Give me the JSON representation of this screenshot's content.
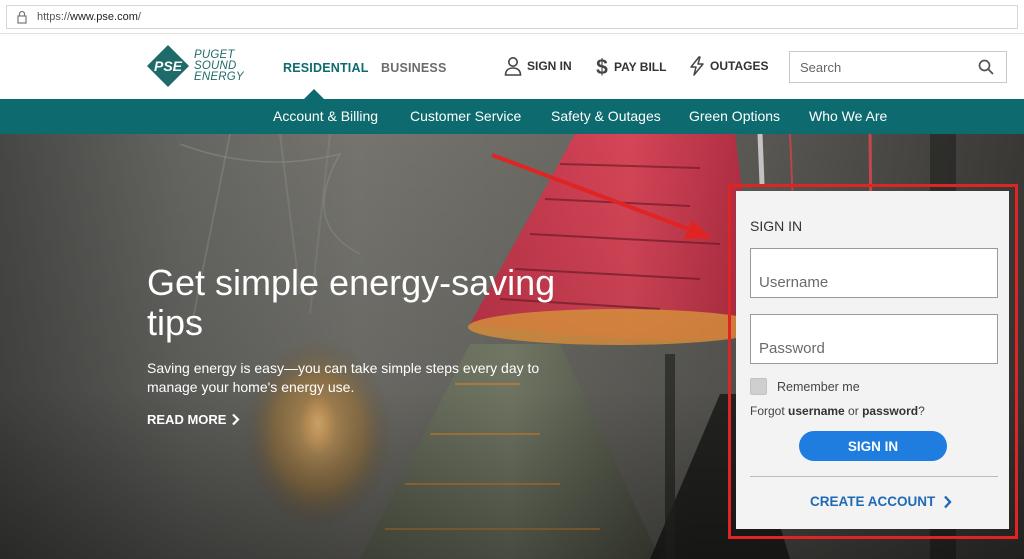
{
  "browser": {
    "url_scheme": "https://",
    "url_host": "www.pse.com",
    "url_path": "/"
  },
  "header": {
    "logo": {
      "mark": "PSE",
      "line1": "PUGET",
      "line2": "SOUND",
      "line3": "ENERGY"
    },
    "tabs": [
      {
        "label": "RESIDENTIAL",
        "active": true
      },
      {
        "label": "BUSINESS",
        "active": false
      }
    ],
    "utilities": [
      {
        "label": "SIGN IN",
        "icon": "user-icon"
      },
      {
        "label": "PAY BILL",
        "icon": "dollar-icon"
      },
      {
        "label": "OUTAGES",
        "icon": "lightning-icon"
      }
    ],
    "search": {
      "placeholder": "Search",
      "value": ""
    }
  },
  "mainnav": {
    "items": [
      "Account & Billing",
      "Customer Service",
      "Safety & Outages",
      "Green Options",
      "Who We Are"
    ]
  },
  "hero": {
    "title": "Get simple energy-saving tips",
    "description": "Saving energy is easy—you can take simple steps every day to manage your home's energy use.",
    "cta": "READ MORE"
  },
  "signin": {
    "title": "SIGN IN",
    "username_placeholder": "Username",
    "password_placeholder": "Password",
    "remember_label": "Remember me",
    "remember_checked": false,
    "forgot_prefix": "Forgot ",
    "forgot_username": "username",
    "forgot_or": " or ",
    "forgot_password": "password",
    "forgot_suffix": "?",
    "button": "SIGN IN",
    "create_account": "CREATE ACCOUNT"
  },
  "colors": {
    "brand_teal": "#0d6a6e",
    "button_blue": "#1f7de0",
    "link_blue": "#1f6ab5",
    "annotation_red": "#e02424"
  }
}
